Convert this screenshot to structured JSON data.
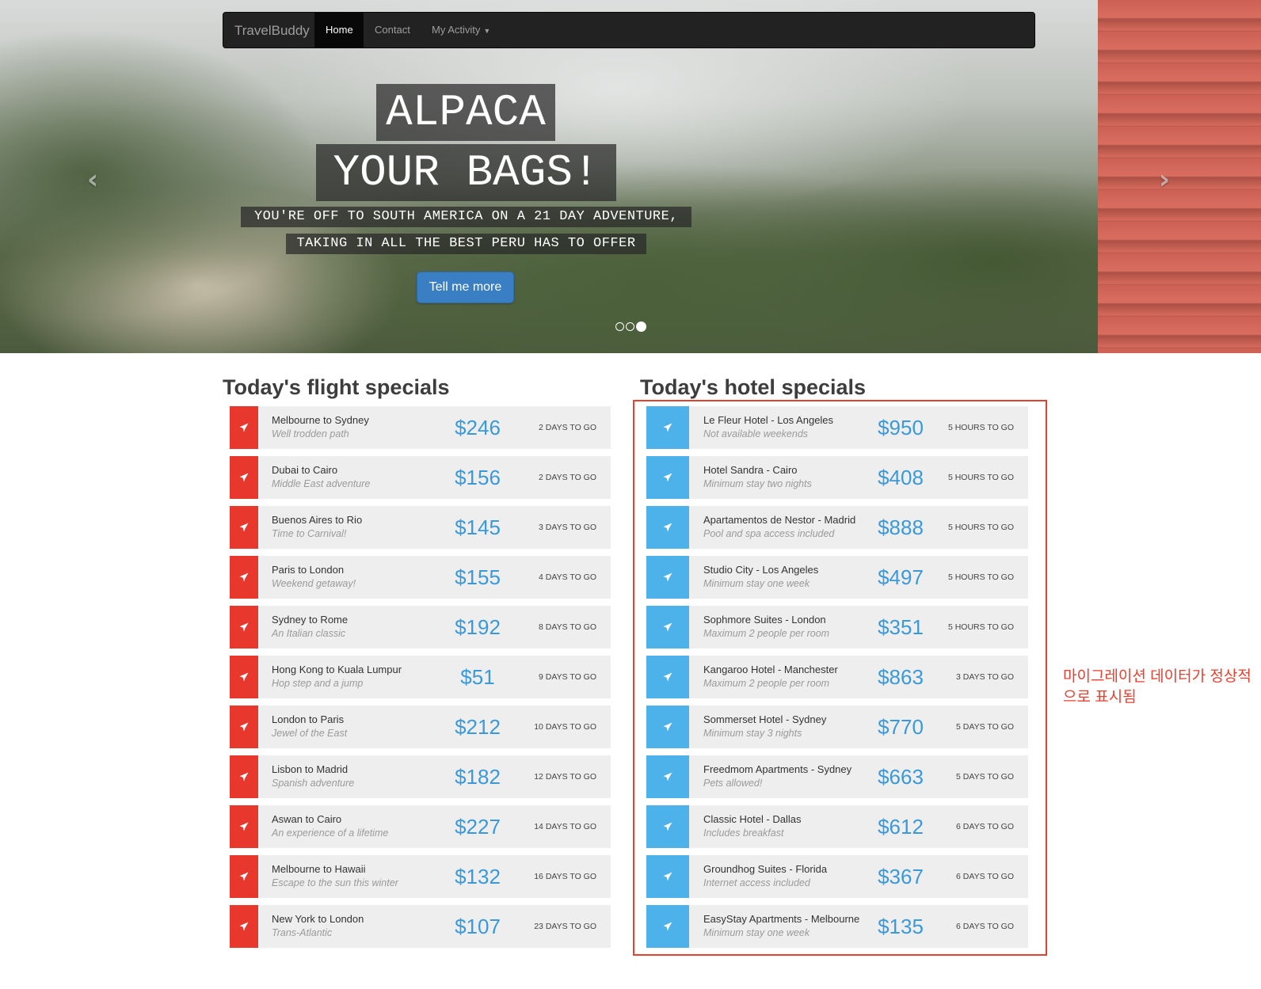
{
  "navbar": {
    "brand": "TravelBuddy",
    "items": [
      {
        "label": "Home",
        "active": true
      },
      {
        "label": "Contact",
        "active": false
      },
      {
        "label": "My Activity",
        "active": false,
        "dropdown": true
      }
    ]
  },
  "hero": {
    "title_line1": "ALPACA",
    "title_line2": "YOUR BAGS!",
    "subtitle_line1": "YOU'RE OFF TO SOUTH AMERICA ON A 21 DAY ADVENTURE,",
    "subtitle_line2": "TAKING IN ALL THE BEST PERU HAS TO OFFER",
    "cta_label": "Tell me more",
    "prev_icon": "chevron-left-icon",
    "next_icon": "chevron-right-icon",
    "slide_count": 3,
    "active_slide": 3
  },
  "flights": {
    "title": "Today's flight specials",
    "accent_color": "#e8382d",
    "icon": "paper-plane-icon",
    "items": [
      {
        "name": "Melbourne to Sydney",
        "desc": "Well trodden path",
        "price": "$246",
        "togo": "2 DAYS TO GO"
      },
      {
        "name": "Dubai to Cairo",
        "desc": "Middle East adventure",
        "price": "$156",
        "togo": "2 DAYS TO GO"
      },
      {
        "name": "Buenos Aires to Rio",
        "desc": "Time to Carnival!",
        "price": "$145",
        "togo": "3 DAYS TO GO"
      },
      {
        "name": "Paris to London",
        "desc": "Weekend getaway!",
        "price": "$155",
        "togo": "4 DAYS TO GO"
      },
      {
        "name": "Sydney to Rome",
        "desc": "An Italian classic",
        "price": "$192",
        "togo": "8 DAYS TO GO"
      },
      {
        "name": "Hong Kong to Kuala Lumpur",
        "desc": "Hop step and a jump",
        "price": "$51",
        "togo": "9 DAYS TO GO"
      },
      {
        "name": "London to Paris",
        "desc": "Jewel of the East",
        "price": "$212",
        "togo": "10 DAYS TO GO"
      },
      {
        "name": "Lisbon to Madrid",
        "desc": "Spanish adventure",
        "price": "$182",
        "togo": "12 DAYS TO GO"
      },
      {
        "name": "Aswan to Cairo",
        "desc": "An experience of a lifetime",
        "price": "$227",
        "togo": "14 DAYS TO GO"
      },
      {
        "name": "Melbourne to Hawaii",
        "desc": "Escape to the sun this winter",
        "price": "$132",
        "togo": "16 DAYS TO GO"
      },
      {
        "name": "New York to London",
        "desc": "Trans-Atlantic",
        "price": "$107",
        "togo": "23 DAYS TO GO"
      }
    ]
  },
  "hotels": {
    "title": "Today's hotel specials",
    "accent_color": "#4db1ea",
    "icon": "paper-plane-icon",
    "items": [
      {
        "name": "Le Fleur Hotel - Los Angeles",
        "desc": "Not available weekends",
        "price": "$950",
        "togo": "5 HOURS TO GO"
      },
      {
        "name": "Hotel Sandra - Cairo",
        "desc": "Minimum stay two nights",
        "price": "$408",
        "togo": "5 HOURS TO GO"
      },
      {
        "name": "Apartamentos de Nestor - Madrid",
        "desc": "Pool and spa access included",
        "price": "$888",
        "togo": "5 HOURS TO GO"
      },
      {
        "name": "Studio City - Los Angeles",
        "desc": "Minimum stay one week",
        "price": "$497",
        "togo": "5 HOURS TO GO"
      },
      {
        "name": "Sophmore Suites - London",
        "desc": "Maximum 2 people per room",
        "price": "$351",
        "togo": "5 HOURS TO GO"
      },
      {
        "name": "Kangaroo Hotel - Manchester",
        "desc": "Maximum 2 people per room",
        "price": "$863",
        "togo": "3 DAYS TO GO"
      },
      {
        "name": "Sommerset Hotel - Sydney",
        "desc": "Minimum stay 3 nights",
        "price": "$770",
        "togo": "5 DAYS TO GO"
      },
      {
        "name": "Freedmom Apartments - Sydney",
        "desc": "Pets allowed!",
        "price": "$663",
        "togo": "5 DAYS TO GO"
      },
      {
        "name": "Classic Hotel - Dallas",
        "desc": "Includes breakfast",
        "price": "$612",
        "togo": "6 DAYS TO GO"
      },
      {
        "name": "Groundhog Suites - Florida",
        "desc": "Internet access included",
        "price": "$367",
        "togo": "6 DAYS TO GO"
      },
      {
        "name": "EasyStay Apartments - Melbourne",
        "desc": "Minimum stay one week",
        "price": "$135",
        "togo": "6 DAYS TO GO"
      }
    ]
  },
  "annotation": {
    "text": "마이그레이션 데이터가 정상적으로 표시됨",
    "color": "#e8402f"
  }
}
